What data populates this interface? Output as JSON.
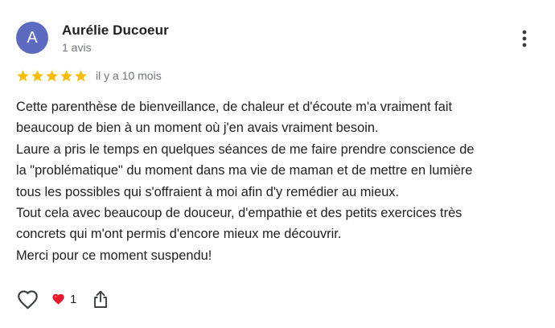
{
  "review": {
    "author": {
      "initial": "A",
      "name": "Aurélie Ducoeur",
      "review_count": "1 avis",
      "avatar_color": "#5c6bc0"
    },
    "rating": 5,
    "rating_max": 5,
    "star_color": "#fbbc04",
    "date": "il y a 10 mois",
    "text_lines": [
      "Cette parenthèse de bienveillance, de chaleur et d'écoute m'a vraiment fait",
      "beaucoup de bien à un moment où j'en avais vraiment besoin.",
      "Laure a pris le temps en quelques séances de me faire prendre conscience de",
      "la \"problématique\" du moment dans ma vie de maman et de mettre en lumière",
      "tous les possibles qui s'offraient à moi afin d'y remédier au mieux.",
      "Tout cela avec beaucoup de douceur, d'empathie et des petits exercices très",
      "concrets qui m'ont permis d'encore mieux me découvrir.",
      "Merci pour ce moment suspendu!"
    ],
    "actions": {
      "like_icon": "heart-outline-icon",
      "reaction_icon": "red-heart-icon",
      "reaction_count": "1",
      "share_icon": "share-icon",
      "more_icon": "more-vert-icon"
    }
  }
}
